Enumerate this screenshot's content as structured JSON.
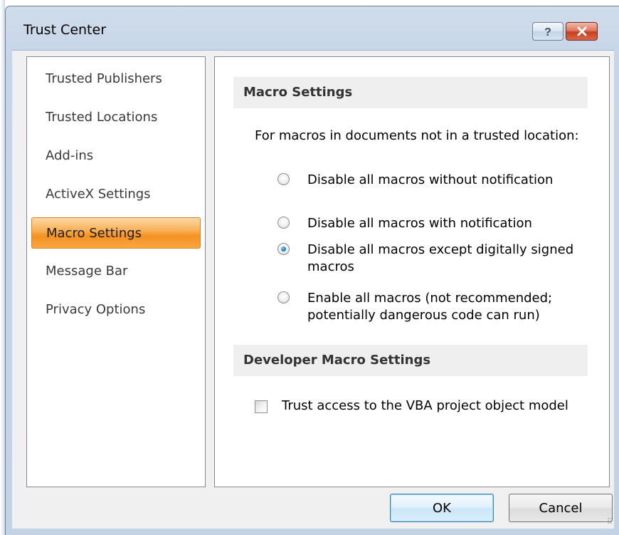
{
  "window": {
    "title": "Trust Center",
    "help_glyph": "?",
    "close_glyph": "×"
  },
  "nav": {
    "items": [
      {
        "label": "Trusted Publishers",
        "selected": false
      },
      {
        "label": "Trusted Locations",
        "selected": false
      },
      {
        "label": "Add-ins",
        "selected": false
      },
      {
        "label": "ActiveX Settings",
        "selected": false
      },
      {
        "label": "Macro Settings",
        "selected": true
      },
      {
        "label": "Message Bar",
        "selected": false
      },
      {
        "label": "Privacy Options",
        "selected": false
      }
    ]
  },
  "macro_settings": {
    "header": "Macro Settings",
    "intro": "For macros in documents not in a trusted location:",
    "options": [
      {
        "label": "Disable all macros without notification",
        "checked": false
      },
      {
        "label": "Disable all macros with notification",
        "checked": false
      },
      {
        "label": "Disable all macros except digitally signed macros",
        "checked": true
      },
      {
        "label": "Enable all macros (not recommended; potentially dangerous code can run)",
        "checked": false
      }
    ]
  },
  "developer_settings": {
    "header": "Developer Macro Settings",
    "checkbox_label": "Trust access to the VBA project object model",
    "checked": false
  },
  "buttons": {
    "ok": "OK",
    "cancel": "Cancel"
  },
  "colors": {
    "selected_nav": "#f59122",
    "title_bar": "#c6d5e7",
    "close_button": "#c83e1f"
  }
}
